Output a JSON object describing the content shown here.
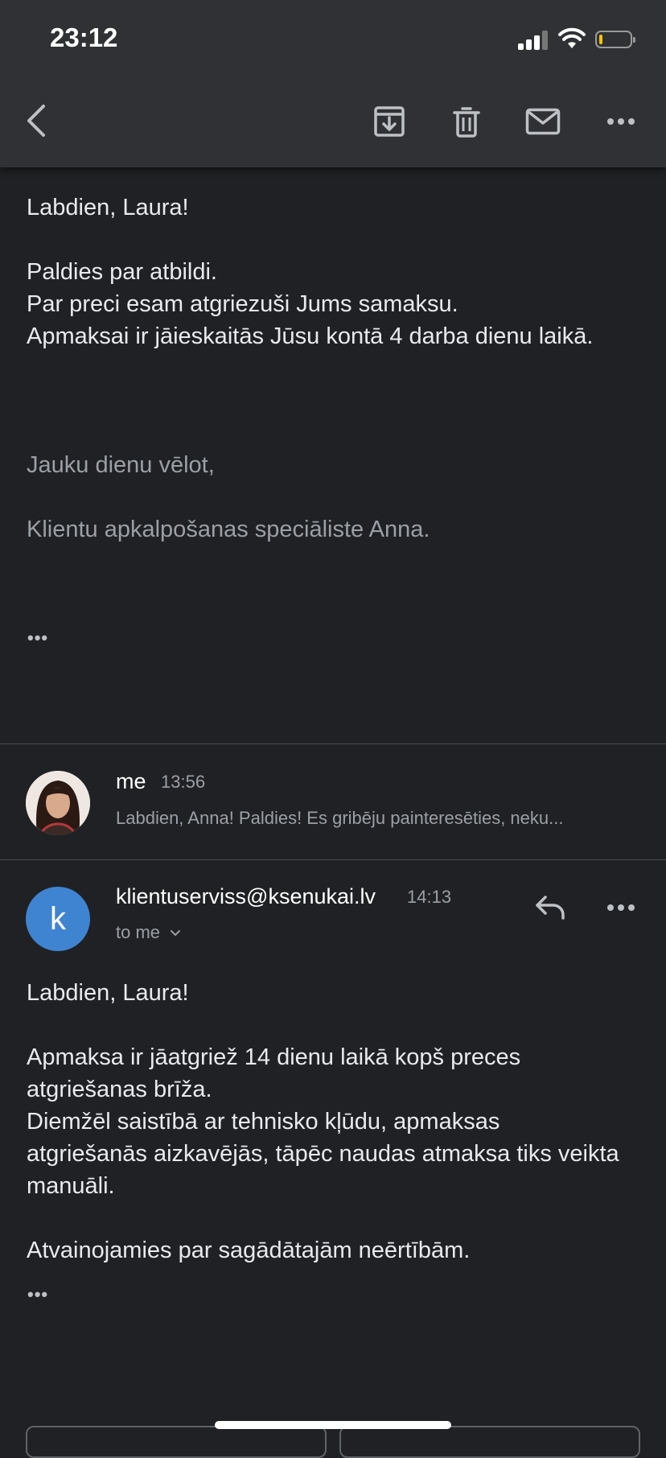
{
  "status_bar": {
    "time": "23:12",
    "battery_level": 0.12,
    "signal_bars": 3
  },
  "toolbar": {
    "back_icon": "chevron-left-icon",
    "actions": [
      "archive-icon",
      "trash-icon",
      "mail-icon",
      "more-horizontal-icon"
    ]
  },
  "message_1": {
    "lines": [
      "Labdien, Laura!",
      "Paldies par atbildi.",
      "Par preci esam atgriezuši Jums samaksu.",
      "Apmaksai ir jāieskaitās Jūsu kontā 4 darba dienu laikā.",
      "Jauku dienu vēlot,",
      "Klientu apkalpošanas speciāliste Anna."
    ],
    "ellipsis": "•••"
  },
  "collapsed_message": {
    "sender": "me",
    "time": "13:56",
    "snippet": "Labdien, Anna! Paldies! Es gribēju painteresēties, neku..."
  },
  "message_2": {
    "sender": "klientuserviss@ksenukai.lv",
    "avatar_letter": "k",
    "time": "14:13",
    "recipient": "to me",
    "lines": [
      "Labdien, Laura!",
      "Apmaksa ir jāatgriež 14 dienu laikā kopš preces atgriešanas brīža.",
      "Diemžēl saistībā ar tehnisko kļūdu, apmaksas atgriešanās aizkavējās, tāpēc naudas atmaksa tiks veikta manuāli.",
      "Atvainojamies par sagādātajām neērtībām."
    ],
    "ellipsis": "•••"
  },
  "colors": {
    "background": "#202124",
    "toolbar": "#303134",
    "avatar_k": "#3f84d1",
    "battery": "#f5c400"
  }
}
